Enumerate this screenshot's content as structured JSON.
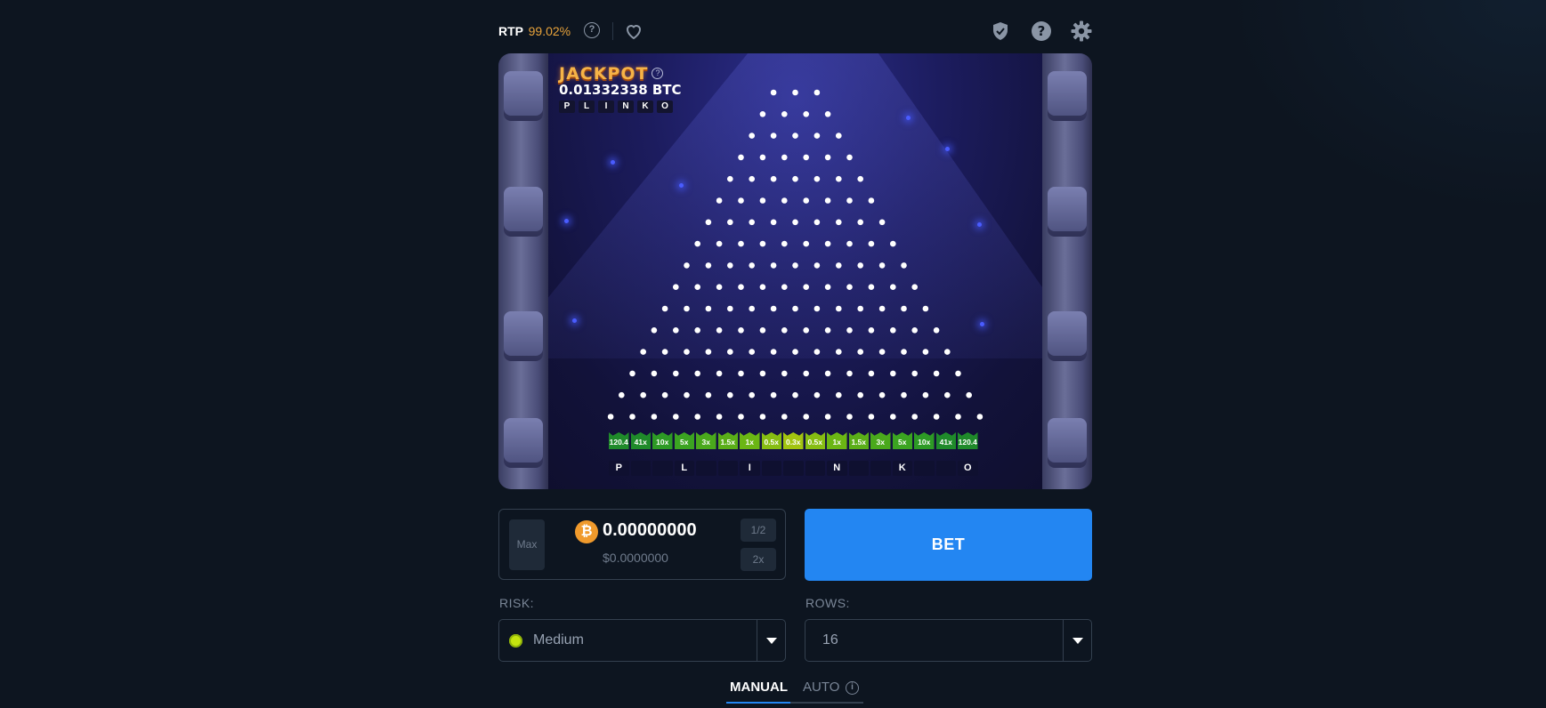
{
  "header": {
    "rtp_label": "RTP",
    "rtp_value": "99.02%",
    "icons": [
      "help-circle-icon",
      "heart-icon",
      "shield-icon",
      "question-icon",
      "gear-icon"
    ]
  },
  "board": {
    "jackpot_title": "JACKPOT",
    "jackpot_help": "?",
    "jackpot_amount": "0.01332338 BTC",
    "jackpot_letters": [
      "P",
      "L",
      "I",
      "N",
      "K",
      "O"
    ],
    "multipliers": [
      "120.4",
      "41x",
      "10x",
      "5x",
      "3x",
      "1.5x",
      "1x",
      "0.5x",
      "0.3x",
      "0.5x",
      "1x",
      "1.5x",
      "3x",
      "5x",
      "10x",
      "41x",
      "120.4"
    ],
    "multiplier_colors": [
      "#1f8a2a",
      "#1f8a2a",
      "#2d9a25",
      "#3ba421",
      "#4aa91c",
      "#5aae18",
      "#6bb614",
      "#86bd12",
      "#a2c410",
      "#86bd12",
      "#6bb614",
      "#5aae18",
      "#4aa91c",
      "#3ba421",
      "#2d9a25",
      "#1f8a2a",
      "#1f8a2a"
    ],
    "bottom_letters": [
      "P",
      "",
      "",
      "L",
      "",
      "",
      "I",
      "",
      "",
      "",
      "N",
      "",
      "",
      "K",
      "",
      "",
      "O"
    ],
    "peg_rows": 16
  },
  "controls": {
    "max_label": "Max",
    "amount": "0.00000000",
    "amount_usd": "$0.0000000",
    "half_label": "1/2",
    "double_label": "2x",
    "bet_label": "BET",
    "risk_label": "RISK:",
    "risk_value": "Medium",
    "rows_label": "ROWS:",
    "rows_value": "16",
    "tab_manual": "MANUAL",
    "tab_auto": "AUTO",
    "info": "i",
    "currency_symbol": "₿"
  }
}
